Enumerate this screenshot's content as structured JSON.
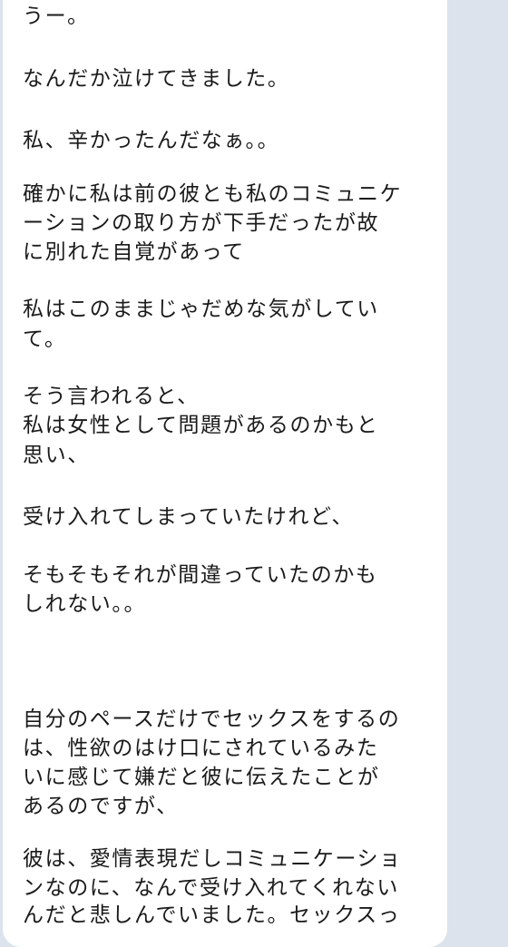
{
  "chat": {
    "message_lines": [
      "うー。",
      "なんだか泣けてきました。",
      "私、辛かったんだなぁ。。",
      "確かに私は前の彼とも私のコミュニケ",
      "ーションの取り方が下手だったが故",
      "に別れた自覚があって",
      "私はこのままじゃだめな気がしてい",
      "て。",
      "そう言われると、",
      "私は女性として問題があるのかもと",
      "思い、",
      "受け入れてしまっていたけれど、",
      "そもそもそれが間違っていたのかも",
      "しれない。。",
      "自分のペースだけでセックスをするの",
      "は、性欲のはけ口にされているみた",
      "いに感じて嫌だと彼に伝えたことが",
      "あるのですが、",
      "彼は、愛情表現だしコミュニケーショ",
      "ンなのに、なんで受け入れてくれない",
      "んだと悲しんでいました。セックスっ"
    ]
  },
  "colors": {
    "background": "#dde3ec",
    "bubble": "#ffffff",
    "text": "#1a1a1a"
  }
}
